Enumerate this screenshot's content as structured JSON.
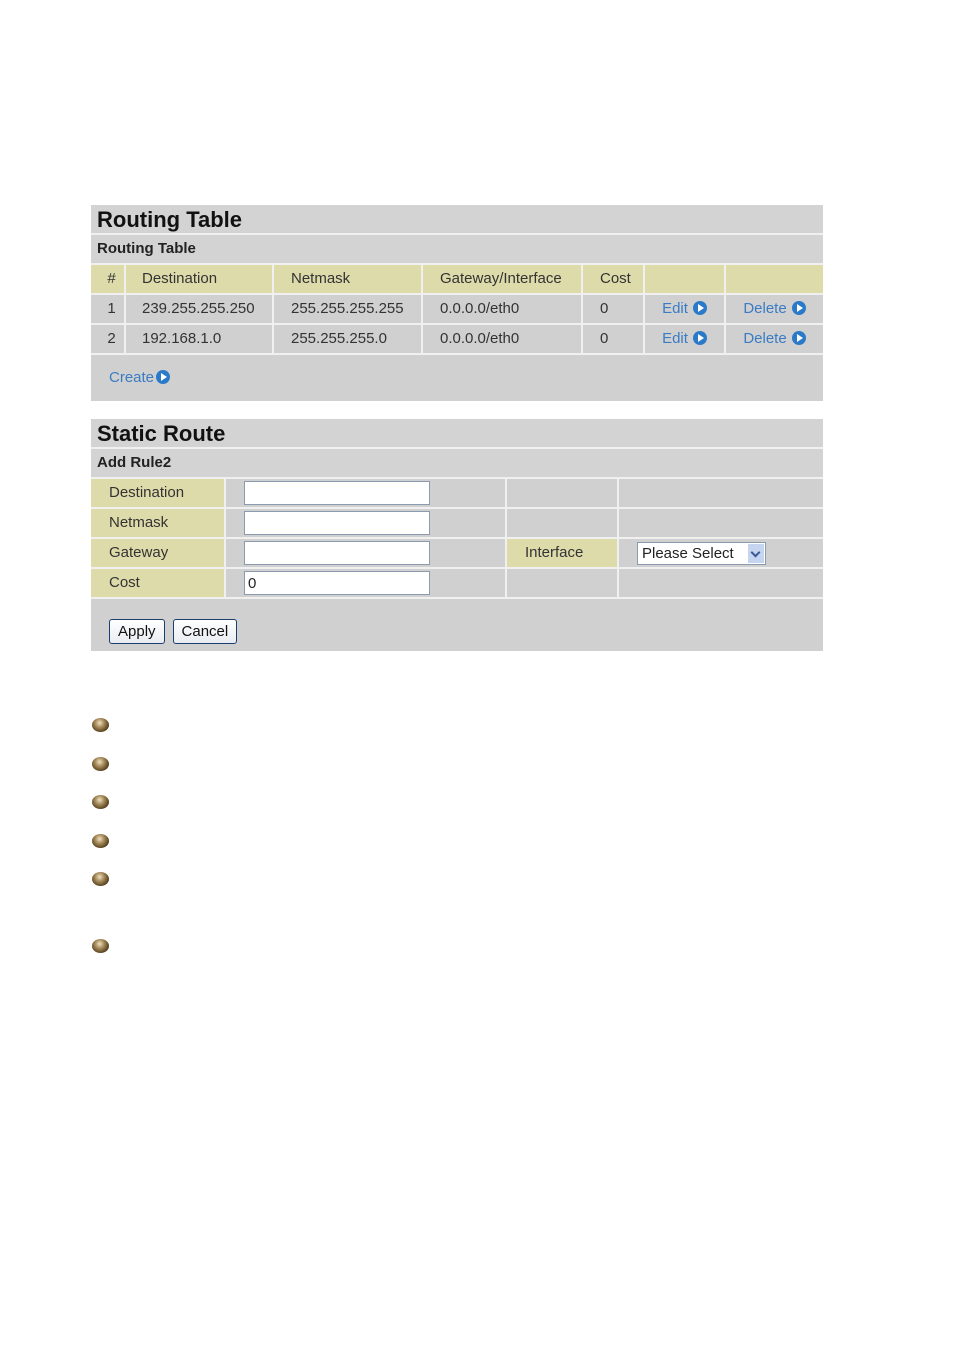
{
  "routing_table": {
    "title": "Routing Table",
    "subtitle": "Routing Table",
    "columns": [
      "#",
      "Destination",
      "Netmask",
      "Gateway/Interface",
      "Cost",
      "",
      ""
    ],
    "rows": [
      {
        "num": "1",
        "destination": "239.255.255.250",
        "netmask": "255.255.255.255",
        "gateway": "0.0.0.0/eth0",
        "cost": "0",
        "edit": "Edit",
        "delete": "Delete"
      },
      {
        "num": "2",
        "destination": "192.168.1.0",
        "netmask": "255.255.255.0",
        "gateway": "0.0.0.0/eth0",
        "cost": "0",
        "edit": "Edit",
        "delete": "Delete"
      }
    ],
    "create_label": "Create"
  },
  "static_route": {
    "title": "Static Route",
    "subtitle": "Add Rule2",
    "fields": {
      "destination": {
        "label": "Destination",
        "value": ""
      },
      "netmask": {
        "label": "Netmask",
        "value": ""
      },
      "gateway": {
        "label": "Gateway",
        "value": ""
      },
      "cost": {
        "label": "Cost",
        "value": "0"
      },
      "interface": {
        "label": "Interface",
        "selected": "Please Select"
      }
    },
    "apply_label": "Apply",
    "cancel_label": "Cancel"
  },
  "bullets": [
    "bullet-icon",
    "bullet-icon",
    "bullet-icon",
    "bullet-icon",
    "bullet-icon",
    "bullet-icon"
  ],
  "colors": {
    "panel_bg": "#d0d0d0",
    "header_bg": "#dedbab",
    "link": "#3a7cc4",
    "arrow": "#2a7ac9"
  }
}
